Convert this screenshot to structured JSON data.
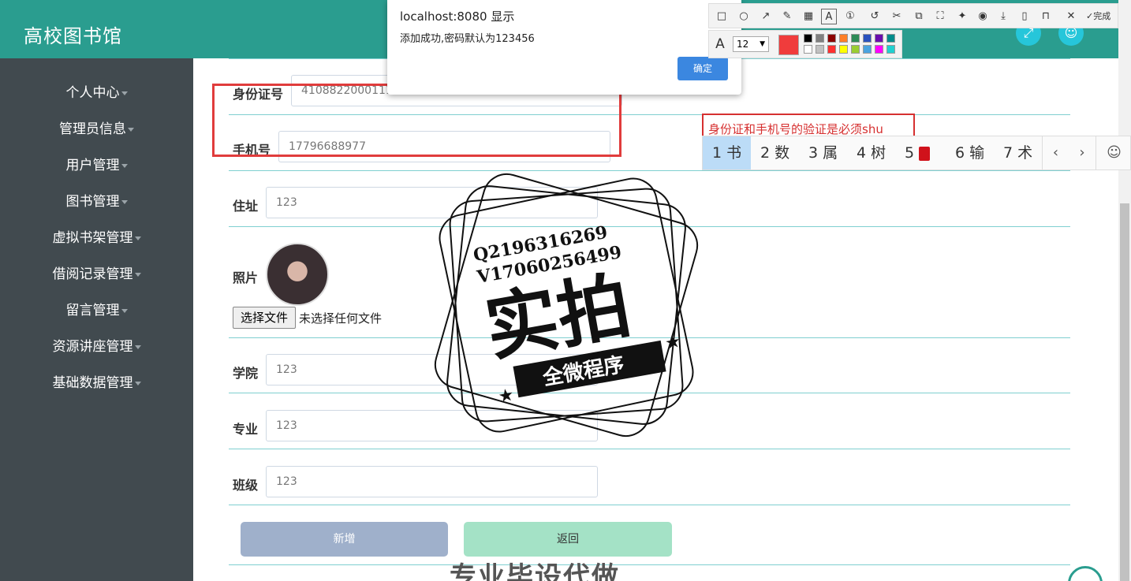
{
  "header": {
    "brand": "高校图书馆"
  },
  "sidebar": {
    "items": [
      {
        "label": "个人中心"
      },
      {
        "label": "管理员信息"
      },
      {
        "label": "用户管理"
      },
      {
        "label": "图书管理"
      },
      {
        "label": "虚拟书架管理"
      },
      {
        "label": "借阅记录管理"
      },
      {
        "label": "留言管理"
      },
      {
        "label": "资源讲座管理"
      },
      {
        "label": "基础数据管理"
      }
    ]
  },
  "form": {
    "id_card": {
      "label": "身份证号",
      "value": "410882200011121111"
    },
    "phone": {
      "label": "手机号",
      "value": "17796688977"
    },
    "address": {
      "label": "住址",
      "value": "123"
    },
    "photo": {
      "label": "照片",
      "file_button": "选择文件",
      "file_status": "未选择任何文件"
    },
    "college": {
      "label": "学院",
      "value": "123"
    },
    "major": {
      "label": "专业",
      "value": "123"
    },
    "class": {
      "label": "班级",
      "value": "123"
    },
    "submit_label": "新增",
    "back_label": "返回"
  },
  "dialog": {
    "title": "localhost:8080 显示",
    "message": "添加成功,密码默认为123456",
    "ok_label": "确定"
  },
  "annotation_tool": {
    "done_label": "完成",
    "font_size": "12",
    "font_icon": "A",
    "selected_color": "#f03c3c",
    "colors_row1": [
      "#000000",
      "#808080",
      "#8b0000",
      "#ff7f27",
      "#2e8b57",
      "#2a52be",
      "#6a0dad",
      "#008b8b"
    ],
    "colors_row2": [
      "#ffffff",
      "#c0c0c0",
      "#ff3030",
      "#ffff00",
      "#9acd32",
      "#4aa3df",
      "#ff00ff",
      "#20d0d0"
    ],
    "text": "身份证和手机号的验证是必须shu"
  },
  "ime": {
    "candidates": [
      "1 书",
      "2 数",
      "3 属",
      "4 树",
      "5",
      "6 输",
      "7 术"
    ],
    "prev": "‹",
    "next": "›",
    "emoji": "☺"
  },
  "watermark": {
    "line1": "Q2196316269",
    "line2": "V17060256499",
    "main": "实拍",
    "banner": "全微程序",
    "bottom": "专业毕设代做"
  }
}
